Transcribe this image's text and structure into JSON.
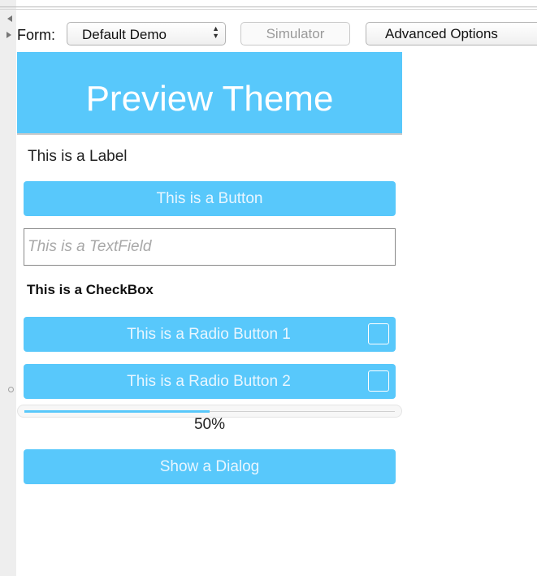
{
  "toolbar": {
    "form_label": "Form:",
    "form_select_value": "Default Demo",
    "simulator_label": "Simulator",
    "advanced_label": "Advanced Options"
  },
  "preview": {
    "title": "Preview Theme",
    "label": "This is a Label",
    "button_label": "This is a Button",
    "textfield_placeholder": "This is a TextField",
    "checkbox_label": "This is a CheckBox",
    "radio1_label": "This is a Radio Button 1",
    "radio2_label": "This is a Radio Button 2",
    "slider_percent": 50,
    "slider_text": "50%",
    "dialog_button_label": "Show a Dialog"
  },
  "colors": {
    "accent": "#58c8fb"
  }
}
